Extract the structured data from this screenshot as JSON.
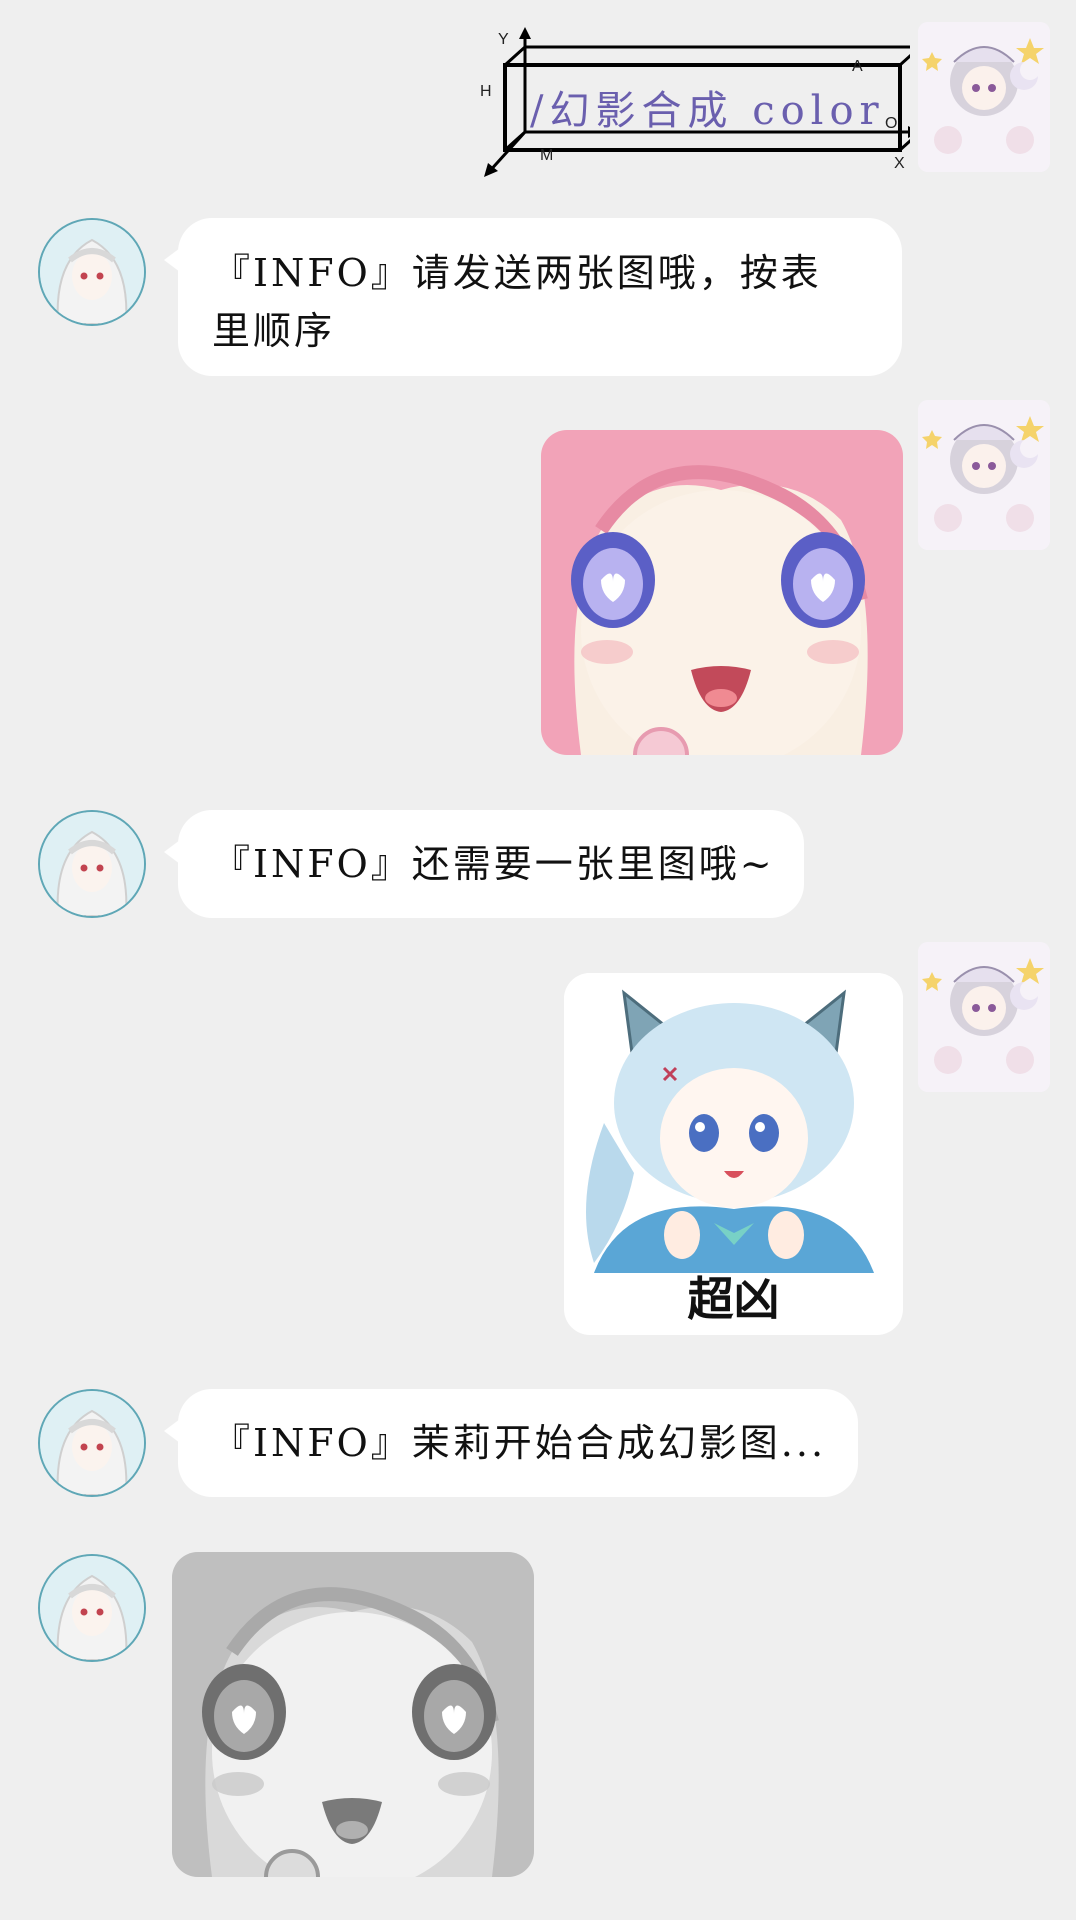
{
  "header": {
    "banner_text": "/幻影合成 color",
    "axis_labels": {
      "y": "Y",
      "h": "H",
      "m": "M",
      "a": "A",
      "o": "O",
      "x": "X"
    }
  },
  "messages": [
    {
      "side": "left",
      "type": "text",
      "text": "『INFO』请发送两张图哦，按表\n里顺序"
    },
    {
      "side": "right",
      "type": "image",
      "image": "pink-hair-anime-face"
    },
    {
      "side": "left",
      "type": "text",
      "text": "『INFO』还需要一张里图哦~"
    },
    {
      "side": "right",
      "type": "image",
      "image": "blue-cat-ear-anime-girl",
      "caption": "超凶"
    },
    {
      "side": "left",
      "type": "text",
      "text": "『INFO』茉莉开始合成幻影图..."
    },
    {
      "side": "left",
      "type": "image",
      "image": "grayscale-anime-face"
    }
  ],
  "colors": {
    "background": "#efefef",
    "bubble": "#ffffff",
    "banner_text": "#6a5fae"
  }
}
